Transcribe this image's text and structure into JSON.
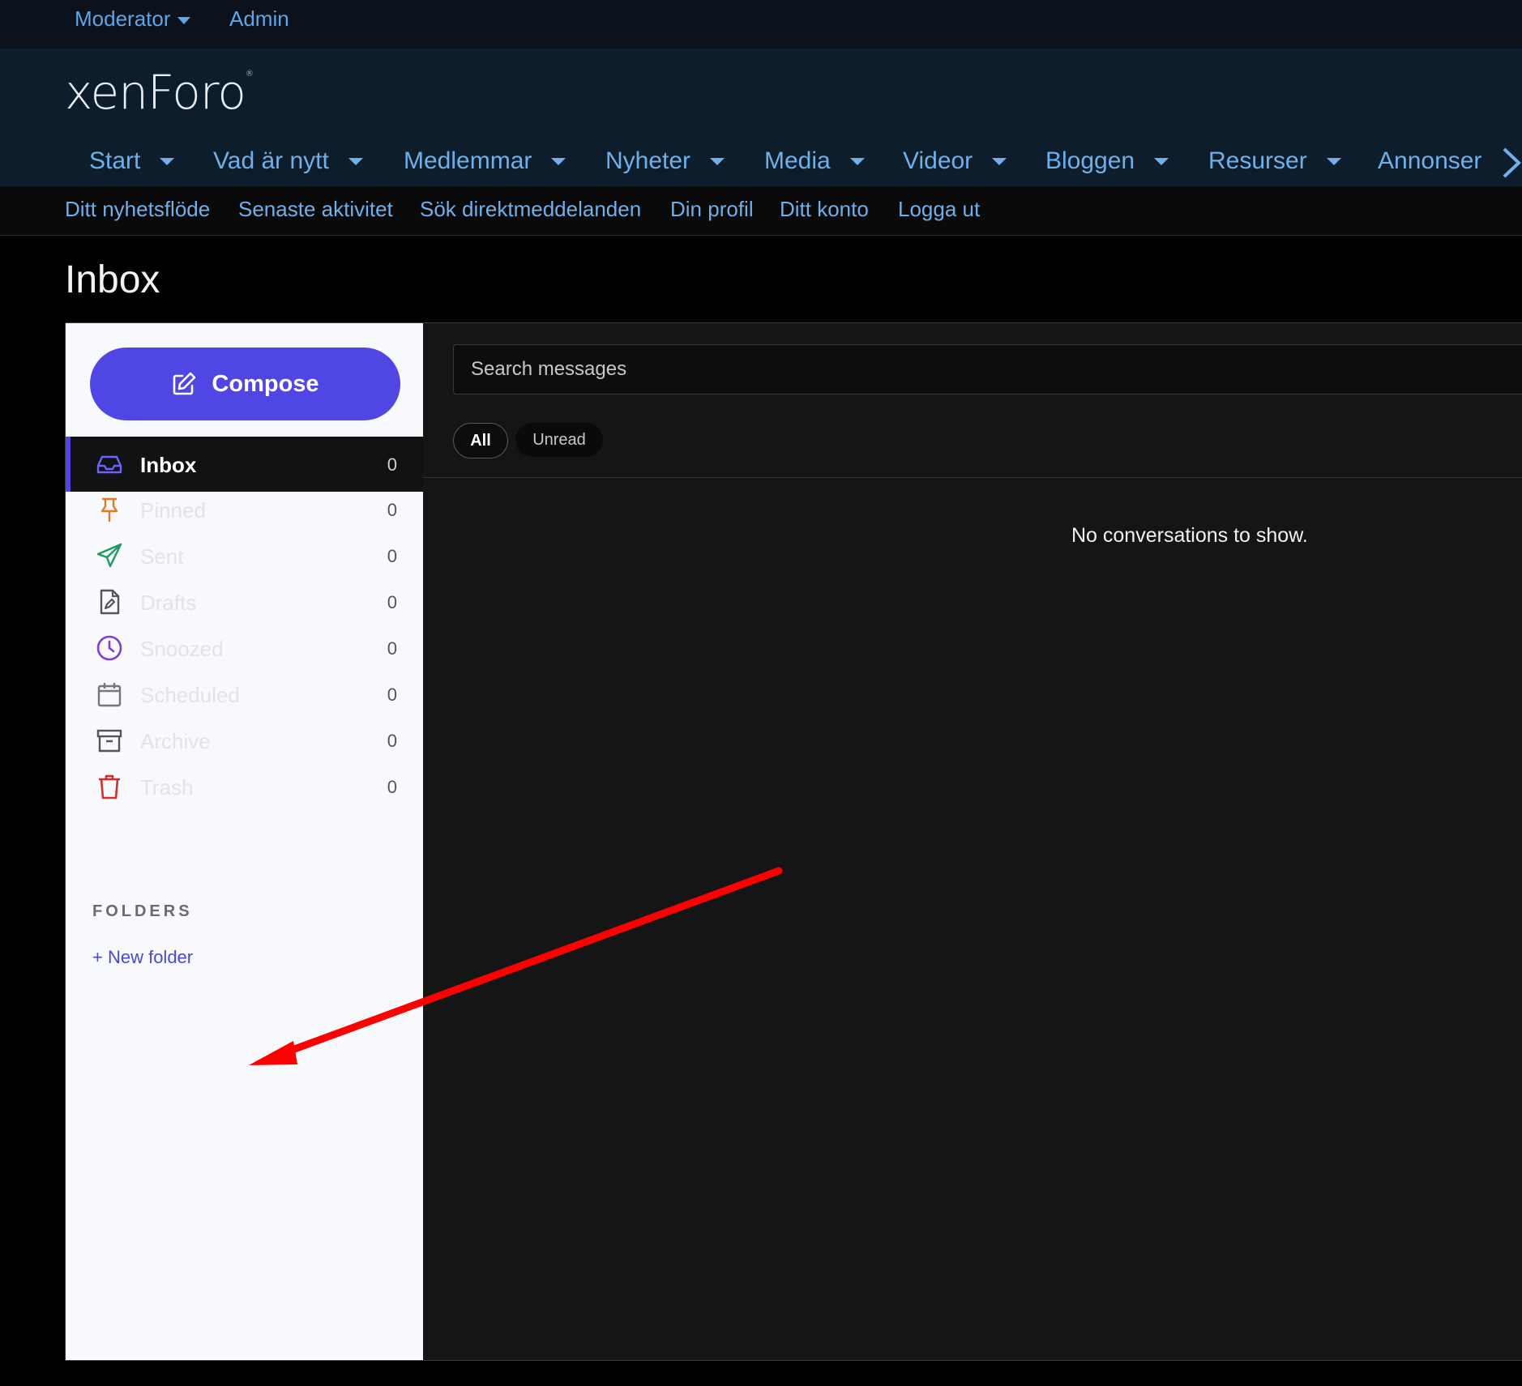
{
  "staff_bar": {
    "moderator": "Moderator",
    "admin": "Admin"
  },
  "header": {
    "logo": "xenForo",
    "logo_mark": "®",
    "nav": [
      "Start",
      "Vad är nytt",
      "Medlemmar",
      "Nyheter",
      "Media",
      "Videor",
      "Bloggen",
      "Resurser",
      "Annonser"
    ]
  },
  "subnav": [
    "Ditt nyhetsflöde",
    "Senaste aktivitet",
    "Sök direktmeddelanden",
    "Din profil",
    "Ditt konto",
    "Logga ut"
  ],
  "page": {
    "title": "Inbox"
  },
  "sidebar": {
    "compose_label": "Compose",
    "items": [
      {
        "label": "Inbox",
        "count": "0",
        "icon": "inbox-icon",
        "active": true
      },
      {
        "label": "Pinned",
        "count": "0",
        "icon": "pin-icon"
      },
      {
        "label": "Sent",
        "count": "0",
        "icon": "paper-plane-icon"
      },
      {
        "label": "Drafts",
        "count": "0",
        "icon": "draft-icon"
      },
      {
        "label": "Snoozed",
        "count": "0",
        "icon": "clock-icon"
      },
      {
        "label": "Scheduled",
        "count": "0",
        "icon": "calendar-icon"
      },
      {
        "label": "Archive",
        "count": "0",
        "icon": "archive-icon"
      },
      {
        "label": "Trash",
        "count": "0",
        "icon": "trash-icon"
      }
    ],
    "folders_heading": "FOLDERS",
    "new_folder_label": "+ New folder"
  },
  "content": {
    "search_placeholder": "Search messages",
    "filters": {
      "all": "All",
      "unread": "Unread"
    },
    "empty_message": "No conversations to show."
  },
  "colors": {
    "accent": "#5046e4",
    "link": "#6fb0ea",
    "header_bg": "#0e1d2b",
    "annotation_arrow": "#ff0000"
  }
}
